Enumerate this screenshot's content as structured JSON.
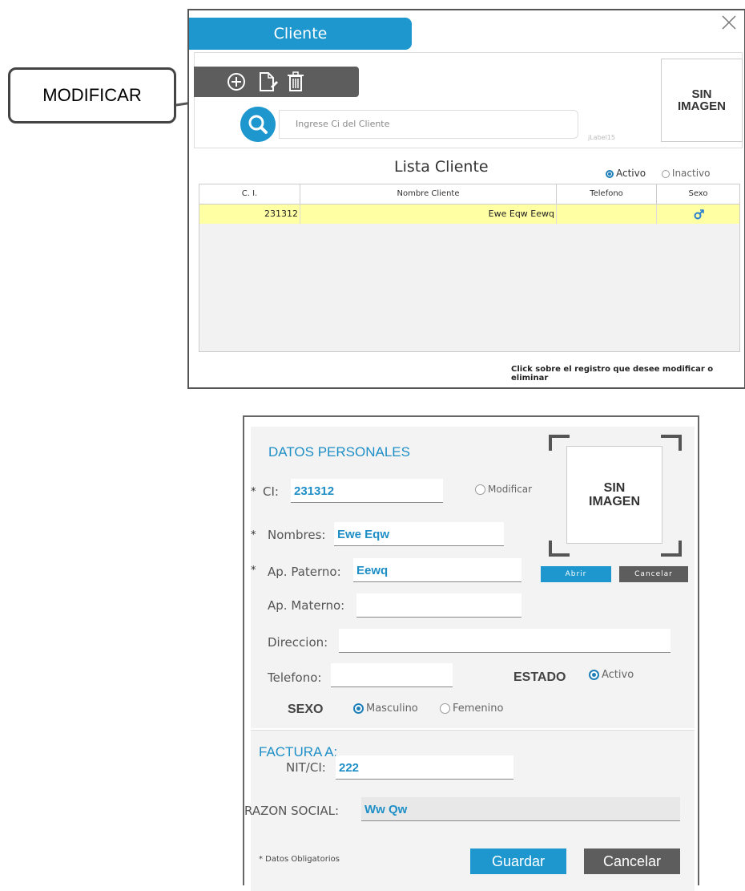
{
  "callout": {
    "label": "MODIFICAR"
  },
  "client_window": {
    "title": "Cliente",
    "search": {
      "placeholder": "Ingrese Ci del Cliente"
    },
    "jlabel": "jLabel15",
    "image_placeholder": {
      "line1": "SIN",
      "line2": "IMAGEN"
    },
    "toolbar": {
      "icons": [
        "add-icon",
        "edit-file-icon",
        "trash-icon"
      ]
    },
    "list": {
      "title": "Lista Cliente",
      "filter": {
        "active_label": "Activo",
        "inactive_label": "Inactivo",
        "selected": "Activo"
      },
      "columns": [
        "C. I.",
        "Nombre Cliente",
        "Telefono",
        "Sexo"
      ],
      "rows": [
        {
          "ci": "231312",
          "nombre": "Ewe Eqw Eewq",
          "telefono": "",
          "sexo_icon": "male-icon"
        }
      ]
    },
    "hint": "Click  sobre el registro que desee modificar o eliminar"
  },
  "form": {
    "section_personal": "DATOS PERSONALES",
    "ci": {
      "label": "CI:",
      "value": "231312"
    },
    "modificar_label": "Modificar",
    "nombres": {
      "label": "Nombres:",
      "value": "Ewe Eqw"
    },
    "ap_paterno": {
      "label": "Ap. Paterno:",
      "value": "Eewq"
    },
    "ap_materno": {
      "label": "Ap. Materno:",
      "value": ""
    },
    "direccion": {
      "label": "Direccion:",
      "value": ""
    },
    "telefono": {
      "label": "Telefono:",
      "value": ""
    },
    "estado": {
      "label": "ESTADO",
      "option": "Activo"
    },
    "sexo": {
      "label": "SEXO",
      "options": [
        "Masculino",
        "Femenino"
      ],
      "selected": "Masculino"
    },
    "image_placeholder": {
      "line1": "SIN",
      "line2": "IMAGEN"
    },
    "abrir_label": "Abrir",
    "cancelar_img_label": "Cancelar",
    "section_factura": "FACTURA A:",
    "nit": {
      "label": "NIT/CI:",
      "value": "222"
    },
    "razon_social": {
      "label": "RAZON SOCIAL:",
      "value": "Ww Qw"
    },
    "required_note": "* Datos Obligatorios",
    "required_mark": "*",
    "guardar_label": "Guardar",
    "cancelar_label": "Cancelar"
  },
  "colors": {
    "accent": "#1e97cf",
    "dark_button": "#5d5d5d",
    "row_highlight": "#ffffa3"
  }
}
